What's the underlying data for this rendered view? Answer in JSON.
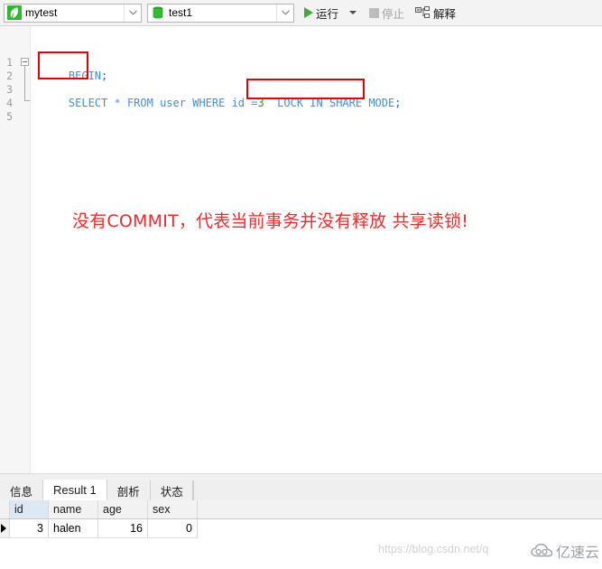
{
  "toolbar": {
    "connection": {
      "icon": "navicat-connection-icon",
      "label": "mytest",
      "arrow": "chevron-down-icon"
    },
    "database": {
      "icon": "database-icon",
      "label": "test1",
      "arrow": "chevron-down-icon"
    },
    "run": {
      "icon": "play-icon",
      "label": "运行",
      "dropdown_icon": "caret-down-icon"
    },
    "stop": {
      "icon": "stop-square-icon",
      "label": "停止",
      "disabled": true
    },
    "explain": {
      "icon": "explain-tree-icon",
      "label": "解释"
    }
  },
  "editor": {
    "line_numbers": [
      "1",
      "2",
      "3",
      "4",
      "5"
    ],
    "lines": {
      "l1_begin": "BEGIN",
      "l1_semi": ";",
      "l3_select": "SELECT",
      "l3_star": " * ",
      "l3_from": "FROM",
      "l3_table": " user ",
      "l3_where": "WHERE",
      "l3_col": " id ",
      "l3_eq": "=",
      "l3_val": "3",
      "l3_lock": "  LOCK IN SHARE MODE",
      "l3_semi": ";"
    },
    "annotation": "没有COMMIT，代表当前事务并没有释放 共享读锁!",
    "annotation_color": "#f0292b",
    "highlight_boxes": [
      {
        "name": "begin-highlight",
        "color": "#e60000"
      },
      {
        "name": "lock-in-share-mode-highlight",
        "color": "#e60000"
      }
    ]
  },
  "results_panel": {
    "tabs": [
      {
        "label": "信息",
        "active": false
      },
      {
        "label": "Result 1",
        "active": true
      },
      {
        "label": "剖析",
        "active": false
      },
      {
        "label": "状态",
        "active": false
      }
    ],
    "grid": {
      "columns": [
        "id",
        "name",
        "age",
        "sex"
      ],
      "selected_column": "id",
      "rows": [
        {
          "id": "3",
          "name": "halen",
          "age": "16",
          "sex": "0"
        }
      ]
    }
  },
  "watermarks": {
    "url": "https://blog.csdn.net/q",
    "brand": "亿速云",
    "brand_icon": "cloud-logo-icon"
  }
}
